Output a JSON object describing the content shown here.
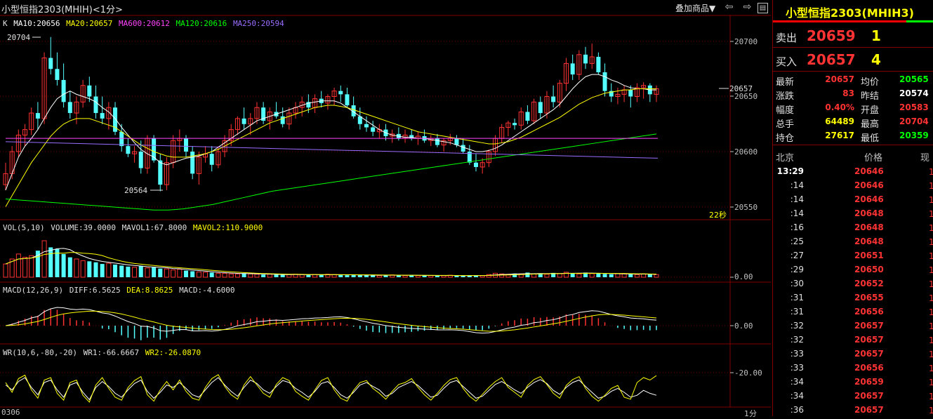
{
  "window": {
    "title": "小型恒指2303(MHIH)",
    "period": "<1分>",
    "overlay_btn": "叠加商品▼",
    "countdown": "22秒",
    "date_label": "0306",
    "period_label": "1分"
  },
  "price_panel": {
    "legend": {
      "k": "K",
      "ma10": "MA10:20656",
      "ma20": "MA20:20657",
      "ma600": "MA600:20612",
      "ma120": "MA120:20616",
      "ma250": "MA250:20594"
    },
    "y_ticks": [
      "20700",
      "20650",
      "20600",
      "20550"
    ],
    "last_price_tag": "20657",
    "high_marker": "20704",
    "low_marker": "20564"
  },
  "volume_panel": {
    "legend": {
      "vol": "VOL(5,10)",
      "volume": "VOLUME:39.0000",
      "mavol1": "MAVOL1:67.8000",
      "mavol2": "MAVOL2:110.9000"
    },
    "y_tick": "0.00"
  },
  "macd_panel": {
    "legend": {
      "macd": "MACD(12,26,9)",
      "diff": "DIFF:6.5625",
      "dea": "DEA:8.8625",
      "macdv": "MACD:-4.6000"
    },
    "y_tick": "0.00"
  },
  "wr_panel": {
    "legend": {
      "wr": "WR(10,6,-80,-20)",
      "wr1": "WR1:-66.6667",
      "wr2": "WR2:-26.0870"
    },
    "y_tick": "-20.00"
  },
  "colors": {
    "up": "#ff3232",
    "down": "#54ffff",
    "ma10": "#ffffff",
    "ma20": "#ffff00",
    "ma600": "#ff44ff",
    "ma120": "#00ff00",
    "ma250": "#9a6cff"
  },
  "chart_data": {
    "type": "candlestick",
    "ylim": [
      20540,
      20715
    ],
    "candles": [
      [
        20570,
        20590,
        20565,
        20580
      ],
      [
        20580,
        20605,
        20575,
        20600
      ],
      [
        20600,
        20620,
        20595,
        20615
      ],
      [
        20615,
        20625,
        20605,
        20620
      ],
      [
        20620,
        20640,
        20615,
        20635
      ],
      [
        20635,
        20645,
        20620,
        20630
      ],
      [
        20630,
        20690,
        20625,
        20685
      ],
      [
        20685,
        20704,
        20670,
        20675
      ],
      [
        20675,
        20690,
        20660,
        20665
      ],
      [
        20665,
        20680,
        20640,
        20645
      ],
      [
        20645,
        20655,
        20630,
        20635
      ],
      [
        20635,
        20650,
        20625,
        20645
      ],
      [
        20645,
        20665,
        20640,
        20660
      ],
      [
        20660,
        20668,
        20645,
        20650
      ],
      [
        20650,
        20660,
        20630,
        20635
      ],
      [
        20635,
        20650,
        20625,
        20630
      ],
      [
        20630,
        20645,
        20620,
        20640
      ],
      [
        20640,
        20645,
        20615,
        20618
      ],
      [
        20618,
        20625,
        20600,
        20605
      ],
      [
        20605,
        20612,
        20595,
        20598
      ],
      [
        20598,
        20605,
        20590,
        20600
      ],
      [
        20600,
        20610,
        20580,
        20585
      ],
      [
        20585,
        20615,
        20580,
        20612
      ],
      [
        20612,
        20615,
        20590,
        20592
      ],
      [
        20592,
        20598,
        20564,
        20570
      ],
      [
        20570,
        20595,
        20565,
        20590
      ],
      [
        20590,
        20615,
        20585,
        20610
      ],
      [
        20610,
        20620,
        20600,
        20612
      ],
      [
        20612,
        20615,
        20595,
        20600
      ],
      [
        20600,
        20605,
        20575,
        20580
      ],
      [
        20580,
        20600,
        20570,
        20595
      ],
      [
        20595,
        20605,
        20590,
        20598
      ],
      [
        20598,
        20605,
        20582,
        20588
      ],
      [
        20588,
        20605,
        20585,
        20600
      ],
      [
        20600,
        20615,
        20595,
        20610
      ],
      [
        20610,
        20625,
        20605,
        20620
      ],
      [
        20620,
        20632,
        20615,
        20630
      ],
      [
        20630,
        20640,
        20620,
        20625
      ],
      [
        20625,
        20635,
        20615,
        20630
      ],
      [
        20630,
        20645,
        20625,
        20640
      ],
      [
        20640,
        20645,
        20625,
        20628
      ],
      [
        20628,
        20640,
        20620,
        20636
      ],
      [
        20636,
        20645,
        20630,
        20632
      ],
      [
        20632,
        20640,
        20622,
        20625
      ],
      [
        20625,
        20640,
        20620,
        20635
      ],
      [
        20635,
        20645,
        20630,
        20640
      ],
      [
        20640,
        20650,
        20632,
        20645
      ],
      [
        20645,
        20652,
        20635,
        20640
      ],
      [
        20640,
        20652,
        20635,
        20648
      ],
      [
        20648,
        20655,
        20640,
        20644
      ],
      [
        20644,
        20652,
        20638,
        20650
      ],
      [
        20650,
        20658,
        20642,
        20655
      ],
      [
        20655,
        20660,
        20645,
        20652
      ],
      [
        20652,
        20658,
        20640,
        20642
      ],
      [
        20642,
        20650,
        20630,
        20632
      ],
      [
        20632,
        20640,
        20620,
        20625
      ],
      [
        20625,
        20632,
        20618,
        20622
      ],
      [
        20622,
        20628,
        20614,
        20618
      ],
      [
        20618,
        20625,
        20612,
        20620
      ],
      [
        20620,
        20625,
        20610,
        20614
      ],
      [
        20614,
        20620,
        20608,
        20616
      ],
      [
        20616,
        20622,
        20610,
        20612
      ],
      [
        20612,
        20620,
        20608,
        20615
      ],
      [
        20615,
        20620,
        20610,
        20612
      ],
      [
        20612,
        20618,
        20606,
        20614
      ],
      [
        20614,
        20620,
        20608,
        20610
      ],
      [
        20610,
        20615,
        20605,
        20612
      ],
      [
        20612,
        20616,
        20604,
        20606
      ],
      [
        20606,
        20612,
        20600,
        20610
      ],
      [
        20610,
        20616,
        20606,
        20612
      ],
      [
        20612,
        20615,
        20604,
        20606
      ],
      [
        20606,
        20612,
        20598,
        20600
      ],
      [
        20600,
        20606,
        20588,
        20590
      ],
      [
        20590,
        20598,
        20582,
        20586
      ],
      [
        20586,
        20594,
        20580,
        20590
      ],
      [
        20590,
        20602,
        20586,
        20600
      ],
      [
        20600,
        20615,
        20596,
        20612
      ],
      [
        20612,
        20625,
        20608,
        20622
      ],
      [
        20622,
        20628,
        20614,
        20626
      ],
      [
        20626,
        20630,
        20620,
        20624
      ],
      [
        20624,
        20640,
        20620,
        20636
      ],
      [
        20636,
        20642,
        20625,
        20628
      ],
      [
        20628,
        20648,
        20625,
        20645
      ],
      [
        20645,
        20650,
        20630,
        20635
      ],
      [
        20635,
        20655,
        20630,
        20650
      ],
      [
        20650,
        20660,
        20640,
        20645
      ],
      [
        20645,
        20665,
        20640,
        20662
      ],
      [
        20662,
        20685,
        20655,
        20680
      ],
      [
        20680,
        20688,
        20665,
        20670
      ],
      [
        20670,
        20692,
        20665,
        20688
      ],
      [
        20688,
        20695,
        20675,
        20680
      ],
      [
        20680,
        20698,
        20675,
        20686
      ],
      [
        20686,
        20690,
        20670,
        20672
      ],
      [
        20672,
        20680,
        20650,
        20655
      ],
      [
        20655,
        20662,
        20645,
        20650
      ],
      [
        20650,
        20658,
        20643,
        20652
      ],
      [
        20652,
        20660,
        20645,
        20656
      ],
      [
        20656,
        20660,
        20640,
        20650
      ],
      [
        20650,
        20662,
        20645,
        20658
      ],
      [
        20658,
        20663,
        20648,
        20660
      ],
      [
        20660,
        20662,
        20645,
        20652
      ],
      [
        20652,
        20660,
        20645,
        20657
      ]
    ],
    "ma10": [
      20565,
      20580,
      20595,
      20605,
      20612,
      20620,
      20630,
      20640,
      20648,
      20652,
      20655,
      20652,
      20650,
      20648,
      20645,
      20640,
      20636,
      20630,
      20622,
      20615,
      20608,
      20602,
      20598,
      20595,
      20590,
      20588,
      20590,
      20592,
      20594,
      20595,
      20596,
      20598,
      20600,
      20604,
      20608,
      20612,
      20616,
      20620,
      20624,
      20628,
      20630,
      20632,
      20634,
      20636,
      20638,
      20640,
      20642,
      20644,
      20645,
      20646,
      20646,
      20646,
      20644,
      20640,
      20636,
      20632,
      20628,
      20624,
      20620,
      20617,
      20615,
      20614,
      20613,
      20613,
      20612,
      20612,
      20611,
      20610,
      20609,
      20608,
      20606,
      20604,
      20602,
      20600,
      20600,
      20601,
      20603,
      20606,
      20610,
      20614,
      20618,
      20622,
      20626,
      20630,
      20634,
      20638,
      20643,
      20650,
      20657,
      20663,
      20668,
      20670,
      20670,
      20668,
      20665,
      20663,
      20660,
      20658,
      20657,
      20657,
      20656,
      20656
    ],
    "ma20": [
      20550,
      20560,
      20570,
      20580,
      20590,
      20598,
      20606,
      20614,
      20620,
      20625,
      20628,
      20630,
      20630,
      20630,
      20628,
      20626,
      20624,
      20622,
      20618,
      20614,
      20610,
      20606,
      20603,
      20600,
      20598,
      20596,
      20595,
      20595,
      20595,
      20596,
      20597,
      20598,
      20600,
      20602,
      20605,
      20608,
      20611,
      20614,
      20617,
      20620,
      20623,
      20626,
      20628,
      20630,
      20632,
      20634,
      20636,
      20638,
      20640,
      20641,
      20642,
      20642,
      20641,
      20640,
      20638,
      20636,
      20634,
      20632,
      20630,
      20628,
      20626,
      20624,
      20622,
      20620,
      20618,
      20617,
      20616,
      20615,
      20614,
      20613,
      20612,
      20611,
      20610,
      20609,
      20608,
      20607,
      20607,
      20608,
      20609,
      20611,
      20613,
      20616,
      20619,
      20622,
      20625,
      20628,
      20631,
      20635,
      20639,
      20643,
      20646,
      20649,
      20651,
      20653,
      20654,
      20655,
      20656,
      20656,
      20657,
      20657,
      20657,
      20657
    ],
    "ma600": 20612,
    "ma120": [
      20557,
      20556,
      20555,
      20554,
      20553,
      20552,
      20551,
      20550,
      20549,
      20548,
      20547,
      20547,
      20548,
      20550,
      20552,
      20555,
      20558,
      20561,
      20564,
      20566,
      20568,
      20570,
      20572,
      20574,
      20576,
      20578,
      20580,
      20582,
      20584,
      20586,
      20588,
      20590,
      20592,
      20594,
      20596,
      20598,
      20600,
      20602,
      20604,
      20606,
      20608,
      20610,
      20612,
      20614,
      20616
    ],
    "ma250_start": 20609,
    "ma250_end": 20594,
    "volume": [
      40,
      55,
      70,
      60,
      65,
      80,
      110,
      90,
      85,
      70,
      60,
      55,
      50,
      48,
      45,
      40,
      42,
      38,
      35,
      32,
      30,
      34,
      28,
      30,
      26,
      25,
      22,
      24,
      20,
      18,
      16,
      15,
      14,
      12,
      12,
      10,
      10,
      12,
      10,
      9,
      8,
      9,
      8,
      7,
      8,
      9,
      8,
      7,
      8,
      7,
      9,
      8,
      7,
      6,
      7,
      6,
      7,
      6,
      5,
      6,
      7,
      6,
      5,
      6,
      5,
      6,
      5,
      4,
      5,
      6,
      5,
      4,
      5,
      6,
      5,
      8,
      12,
      10,
      9,
      11,
      9,
      14,
      10,
      12,
      9,
      13,
      11,
      15,
      12,
      10,
      14,
      11,
      12,
      10,
      9,
      11,
      10,
      9,
      8,
      10,
      9,
      8
    ],
    "wr1": [
      -45,
      -55,
      -38,
      -30,
      -50,
      -65,
      -40,
      -35,
      -55,
      -70,
      -45,
      -40,
      -60,
      -75,
      -50,
      -38,
      -48,
      -62,
      -70,
      -55,
      -42,
      -35,
      -58,
      -72,
      -60,
      -45,
      -50,
      -40,
      -52,
      -65,
      -70,
      -55,
      -40,
      -30,
      -45,
      -58,
      -68,
      -50,
      -35,
      -42,
      -55,
      -62,
      -48,
      -36,
      -40,
      -52,
      -60,
      -70,
      -58,
      -42,
      -38,
      -50,
      -65,
      -72,
      -60,
      -45,
      -40,
      -48,
      -55,
      -68,
      -62,
      -50,
      -44,
      -38,
      -46,
      -58,
      -70,
      -66,
      -52,
      -40,
      -36,
      -48,
      -60,
      -72,
      -68,
      -56,
      -44,
      -38,
      -46,
      -55,
      -62,
      -50,
      -40,
      -34,
      -42,
      -56,
      -64,
      -50,
      -40,
      -35,
      -48,
      -60,
      -72,
      -68,
      -58,
      -52,
      -60,
      -70,
      -66,
      -56,
      -62,
      -66
    ],
    "wr2": [
      -40,
      -60,
      -32,
      -25,
      -55,
      -72,
      -35,
      -30,
      -62,
      -76,
      -40,
      -35,
      -66,
      -80,
      -45,
      -30,
      -52,
      -70,
      -76,
      -50,
      -36,
      -28,
      -65,
      -78,
      -55,
      -38,
      -55,
      -35,
      -58,
      -72,
      -76,
      -50,
      -32,
      -24,
      -48,
      -65,
      -74,
      -45,
      -28,
      -45,
      -62,
      -70,
      -44,
      -30,
      -36,
      -58,
      -68,
      -76,
      -55,
      -36,
      -30,
      -55,
      -72,
      -78,
      -56,
      -40,
      -36,
      -52,
      -62,
      -74,
      -58,
      -44,
      -40,
      -32,
      -50,
      -65,
      -76,
      -62,
      -46,
      -34,
      -30,
      -52,
      -68,
      -78,
      -64,
      -50,
      -38,
      -30,
      -50,
      -60,
      -70,
      -46,
      -34,
      -28,
      -44,
      -62,
      -72,
      -46,
      -34,
      -28,
      -52,
      -68,
      -78,
      -66,
      -52,
      -46,
      -70,
      -74,
      -40,
      -30,
      -35,
      -26
    ]
  },
  "quote": {
    "title": "小型恒指2303(MHIH3)",
    "sell_label": "卖出",
    "sell_price": "20659",
    "sell_vol": "1",
    "buy_label": "买入",
    "buy_price": "20657",
    "buy_vol": "4",
    "stats": [
      {
        "l": "最新",
        "v": "20657",
        "vc": "#ff3232",
        "l2": "均价",
        "v2": "20565",
        "v2c": "#00ff00"
      },
      {
        "l": "涨跌",
        "v": "83",
        "vc": "#ff3232",
        "l2": "昨结",
        "v2": "20574",
        "v2c": "#ffffff"
      },
      {
        "l": "幅度",
        "v": "0.40%",
        "vc": "#ff3232",
        "l2": "开盘",
        "v2": "20583",
        "v2c": "#ff3232"
      },
      {
        "l": "总手",
        "v": "64489",
        "vc": "#ffff00",
        "l2": "最高",
        "v2": "20704",
        "v2c": "#ff3232"
      },
      {
        "l": "持仓",
        "v": "27617",
        "vc": "#ffff00",
        "l2": "最低",
        "v2": "20359",
        "v2c": "#00ff00"
      }
    ],
    "ticks_header": {
      "place": "北京",
      "price": "价格",
      "now": "现手"
    },
    "ticks": [
      {
        "t": "13:29",
        "p": "20646"
      },
      {
        "t": ":14",
        "p": "20646"
      },
      {
        "t": ":14",
        "p": "20646"
      },
      {
        "t": ":14",
        "p": "20648"
      },
      {
        "t": ":16",
        "p": "20648"
      },
      {
        "t": ":25",
        "p": "20648"
      },
      {
        "t": ":27",
        "p": "20651"
      },
      {
        "t": ":29",
        "p": "20650"
      },
      {
        "t": ":30",
        "p": "20652"
      },
      {
        "t": ":31",
        "p": "20655"
      },
      {
        "t": ":31",
        "p": "20656"
      },
      {
        "t": ":32",
        "p": "20657"
      },
      {
        "t": ":32",
        "p": "20657"
      },
      {
        "t": ":33",
        "p": "20657"
      },
      {
        "t": ":33",
        "p": "20656"
      },
      {
        "t": ":34",
        "p": "20659"
      },
      {
        "t": ":34",
        "p": "20657"
      },
      {
        "t": ":36",
        "p": "20657"
      }
    ]
  }
}
